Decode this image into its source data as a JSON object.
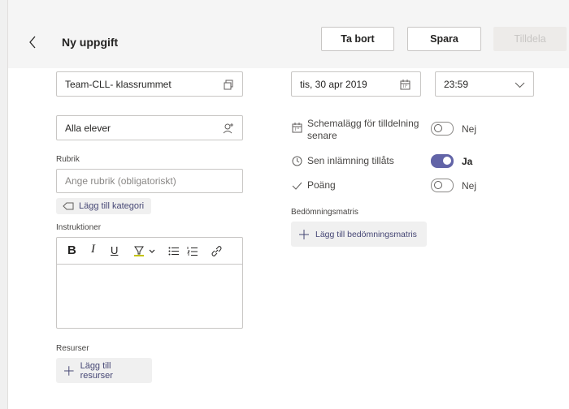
{
  "header": {
    "title": "Ny uppgift",
    "delete_label": "Ta bort",
    "save_label": "Spara",
    "assign_label": "Tilldela"
  },
  "left": {
    "class_value": "Team-CLL- klassrummet",
    "students_value": "Alla elever",
    "title_label": "Rubrik",
    "title_placeholder": "Ange rubrik (obligatoriskt)",
    "add_category_label": "Lägg till kategori",
    "instructions_label": "Instruktioner",
    "resources_label": "Resurser",
    "add_resources_label": "Lägg till resurser"
  },
  "right": {
    "due_date": "tis, 30 apr 2019",
    "due_time": "23:59",
    "schedule_label": "Schemalägg för tilldelning senare",
    "schedule_value": "Nej",
    "schedule_on": false,
    "late_label": "Sen inlämning tillåts",
    "late_value": "Ja",
    "late_on": true,
    "points_label": "Poäng",
    "points_value": "Nej",
    "points_on": false,
    "rubric_label": "Bedömningsmatris",
    "add_rubric_label": "Lägg till bedömningsmatris"
  },
  "colors": {
    "accent": "#6264a7",
    "highlighter": "#c4c400"
  },
  "toolbar_icons": [
    "bold-icon",
    "italic-icon",
    "underline-icon",
    "highlight-icon",
    "chevron-down-icon",
    "bullet-list-icon",
    "numbered-list-icon",
    "link-icon"
  ]
}
